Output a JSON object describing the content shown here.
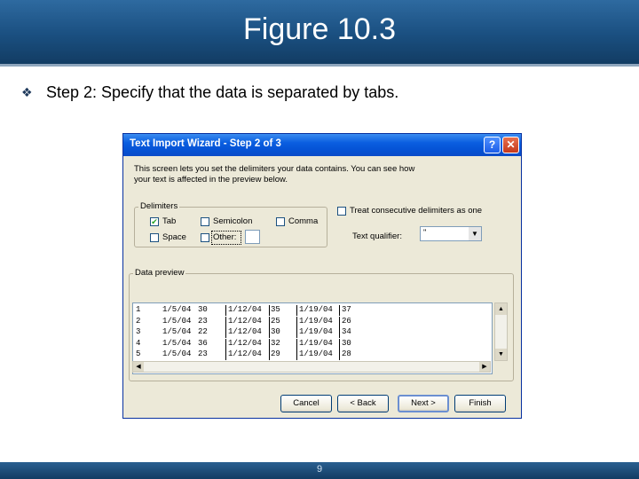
{
  "slide": {
    "title": "Figure 10.3",
    "bullet_icon": "diamond-bullet-icon",
    "bullet_text": "Step 2: Specify that the data is separated by tabs.",
    "page_number": "9"
  },
  "dialog": {
    "title": "Text Import Wizard - Step 2 of 3",
    "help_label": "?",
    "close_label": "✕",
    "description": "This screen lets you set the delimiters your data contains. You can see how your text is affected in the preview below.",
    "delimiters": {
      "legend": "Delimiters",
      "tab": {
        "label": "Tab",
        "checked": true
      },
      "semicolon": {
        "label": "Semicolon",
        "checked": false
      },
      "comma": {
        "label": "Comma",
        "checked": false
      },
      "space": {
        "label": "Space",
        "checked": false
      },
      "other": {
        "label": "Other:",
        "checked": false,
        "value": ""
      }
    },
    "treat_consecutive": {
      "label": "Treat consecutive delimiters as one",
      "checked": false
    },
    "text_qualifier": {
      "label": "Text qualifier:",
      "value": "\""
    },
    "data_preview": {
      "legend": "Data preview",
      "rows": [
        [
          "1",
          "1/5/04",
          "30",
          "1/12/04",
          "35",
          "1/19/04",
          "37"
        ],
        [
          "2",
          "1/5/04",
          "23",
          "1/12/04",
          "25",
          "1/19/04",
          "26"
        ],
        [
          "3",
          "1/5/04",
          "22",
          "1/12/04",
          "30",
          "1/19/04",
          "34"
        ],
        [
          "4",
          "1/5/04",
          "36",
          "1/12/04",
          "32",
          "1/19/04",
          "30"
        ],
        [
          "5",
          "1/5/04",
          "23",
          "1/12/04",
          "29",
          "1/19/04",
          "28"
        ]
      ]
    },
    "buttons": {
      "cancel": "Cancel",
      "back": "< Back",
      "next": "Next >",
      "finish": "Finish"
    }
  }
}
